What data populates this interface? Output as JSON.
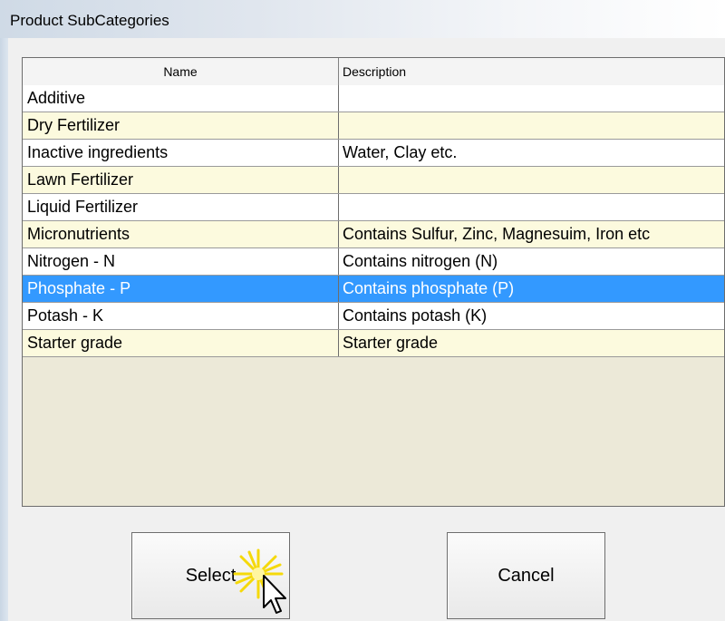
{
  "window": {
    "title": "Product SubCategories"
  },
  "grid": {
    "columns": [
      "Name",
      "Description"
    ],
    "rows": [
      {
        "name": "Additive",
        "description": ""
      },
      {
        "name": "Dry Fertilizer",
        "description": ""
      },
      {
        "name": "Inactive ingredients",
        "description": "Water, Clay etc."
      },
      {
        "name": "Lawn Fertilizer",
        "description": ""
      },
      {
        "name": "Liquid Fertilizer",
        "description": ""
      },
      {
        "name": "Micronutrients",
        "description": "Contains Sulfur, Zinc, Magnesuim, Iron etc"
      },
      {
        "name": "Nitrogen - N",
        "description": "Contains nitrogen (N)"
      },
      {
        "name": "Phosphate - P",
        "description": "Contains phosphate (P)"
      },
      {
        "name": "Potash - K",
        "description": "Contains potash (K)"
      },
      {
        "name": "Starter grade",
        "description": "Starter grade"
      }
    ],
    "selected_index": 7
  },
  "buttons": {
    "select_label": "Select",
    "cancel_label": "Cancel"
  },
  "colors": {
    "selection": "#3399ff",
    "alt_row": "#fcfade",
    "grid_empty": "#ece9d8",
    "sparkle": "#f5d90a"
  },
  "icons": {
    "cursor": "mouse-pointer-icon",
    "sparkle": "click-sparkle-icon"
  }
}
